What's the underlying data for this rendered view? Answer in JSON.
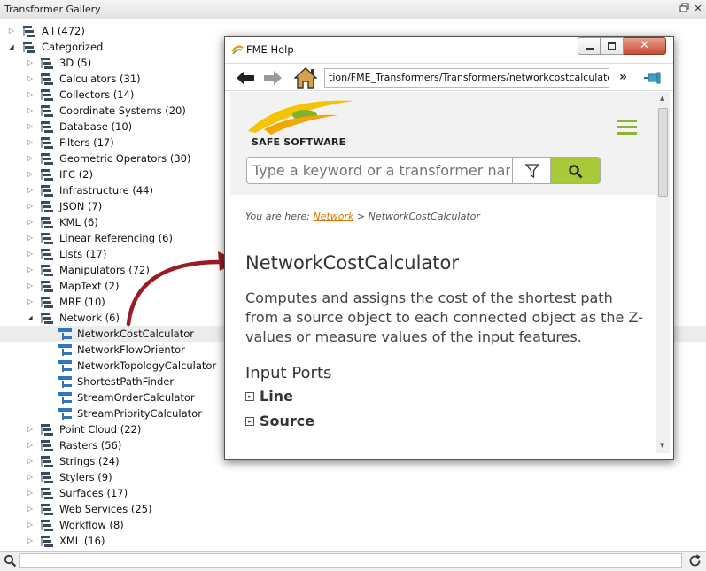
{
  "panel": {
    "title": "Transformer Gallery"
  },
  "tree": {
    "all_label": "All (472)",
    "categorized_label": "Categorized",
    "categories": [
      "3D (5)",
      "Calculators (31)",
      "Collectors (14)",
      "Coordinate Systems (20)",
      "Database (10)",
      "Filters (17)",
      "Geometric Operators (30)",
      "IFC (2)",
      "Infrastructure (44)",
      "JSON (7)",
      "KML (6)",
      "Linear Referencing (6)",
      "Lists (17)",
      "Manipulators (72)",
      "MapText (2)",
      "MRF (10)"
    ],
    "network_label": "Network (6)",
    "network_children": [
      "NetworkCostCalculator",
      "NetworkFlowOrientor",
      "NetworkTopologyCalculator",
      "ShortestPathFinder",
      "StreamOrderCalculator",
      "StreamPriorityCalculator"
    ],
    "categories_after": [
      "Point Cloud (22)",
      "Rasters (56)",
      "Strings (24)",
      "Stylers (9)",
      "Surfaces (17)",
      "Web Services (25)",
      "Workflow (8)",
      "XML (16)"
    ],
    "selected_item": "NetworkCostCalculator"
  },
  "search": {
    "value": "",
    "placeholder": ""
  },
  "help": {
    "window_title": "FME Help",
    "address": "tion/FME_Transformers/Transformers/networkcostcalculator.htm",
    "logo_text": "SAFE SOFTWARE",
    "search_placeholder": "Type a keyword or a transformer name",
    "breadcrumb_prefix": "You are here:",
    "breadcrumb_link": "Network",
    "breadcrumb_separator": ">",
    "breadcrumb_current": "NetworkCostCalculator",
    "heading": "NetworkCostCalculator",
    "description": "Computes and assigns the cost of the shortest path from a source object to each connected object as the Z-values or measure values of the input features.",
    "input_ports_heading": "Input Ports",
    "ports": [
      "Line",
      "Source"
    ]
  },
  "colors": {
    "accent_green": "#a8c93a",
    "arrow_red": "#9b1b24",
    "link_orange": "#d97a00",
    "logo_yellow": "#f5c400"
  },
  "icons": {
    "node": "transformer-node-icon",
    "category": "category-tree-icon",
    "refresh": "refresh-icon",
    "search": "search-icon"
  }
}
